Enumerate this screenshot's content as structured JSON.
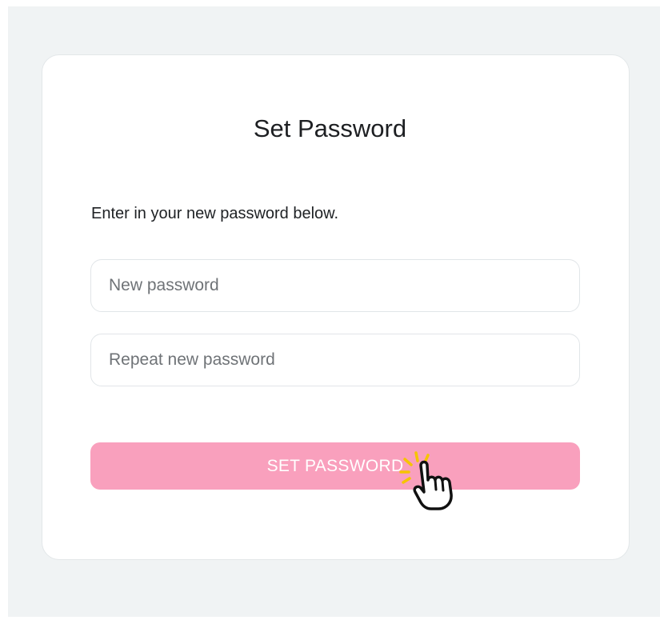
{
  "form": {
    "title": "Set Password",
    "instruction": "Enter in your new password below.",
    "new_password_placeholder": "New password",
    "repeat_password_placeholder": "Repeat new password",
    "submit_label": "SET PASSWORD"
  },
  "colors": {
    "background": "#f0f3f4",
    "card": "#ffffff",
    "button": "#f9a0bd",
    "button_text": "#ffffff",
    "cursor_sparkle": "#f6c400"
  },
  "icons": {
    "cursor": "hand-pointer-click-icon"
  }
}
